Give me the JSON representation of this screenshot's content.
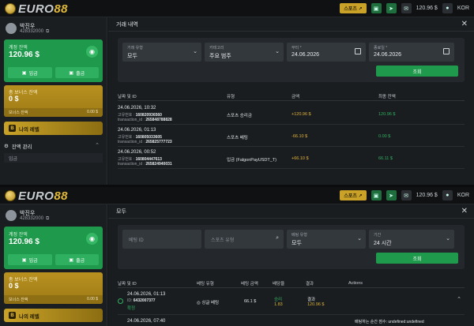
{
  "panels": [
    {
      "topbar": {
        "logo_pre": "EURO",
        "logo_num": "88",
        "pill": "스포츠 ↗",
        "balance": "120.96 $",
        "lang": "KOR"
      },
      "user": {
        "name": "박진우",
        "id": "428332000"
      },
      "balance": {
        "label": "계정 잔액",
        "value": "120.96 $",
        "deposit": "입금",
        "withdraw": "출금"
      },
      "bonus": {
        "label": "총 보너스 잔액",
        "value": "0 $",
        "foot_label": "보너스 잔액",
        "foot_value": "0.00 $"
      },
      "level": "나의 레벨",
      "section": "잔액 관리",
      "subitem": "입금",
      "title": "거래 내역",
      "filters": [
        {
          "label": "거래 유형",
          "value": "모두"
        },
        {
          "label": "카테고리",
          "value": "주요 범주"
        },
        {
          "label": "부터 *",
          "value": "24.06.2026"
        },
        {
          "label": "종료일 *",
          "value": "24.06.2026"
        }
      ],
      "submit": "조회",
      "headers": [
        "날짜 및 ID",
        "유형",
        "금액",
        "최종 잔액"
      ],
      "rows": [
        {
          "date": "24.06.2026, 10:32",
          "code_label": "고유번호 :",
          "code": "160820936560",
          "tx_label": "transaction_id :",
          "tx": "265848788828",
          "type": "스포츠 승리금",
          "amount": "+120.96 $",
          "balance": "120.96 $"
        },
        {
          "date": "24.06.2026, 01:13",
          "code_label": "고유번호 :",
          "code": "160805033605",
          "tx_label": "transaction_id :",
          "tx": "265825777723",
          "type": "스포츠 베팅",
          "amount": "-66.10 $",
          "balance": "0.00 $"
        },
        {
          "date": "24.06.2026, 00:52",
          "code_label": "고유번호 :",
          "code": "160804447613",
          "tx_label": "transaction_id :",
          "tx": "265824940031",
          "type": "입금 (FalgonPayUSDT_T)",
          "amount": "+66.10 $",
          "balance": "66.11 $"
        }
      ]
    },
    {
      "topbar": {
        "logo_pre": "EURO",
        "logo_num": "88",
        "pill": "스포츠 ↗",
        "balance": "120.96 $",
        "lang": "KOR"
      },
      "user": {
        "name": "박진우",
        "id": "428332000"
      },
      "balance": {
        "label": "계정 잔액",
        "value": "120.96 $",
        "deposit": "입금",
        "withdraw": "출금"
      },
      "bonus": {
        "label": "총 보너스 잔액",
        "value": "0 $",
        "foot_label": "보너스 잔액",
        "foot_value": "0.00 $"
      },
      "level": "나의 레벨",
      "title": "모두",
      "filters": [
        {
          "placeholder": "베팅 ID"
        },
        {
          "placeholder": "스포츠 유형"
        },
        {
          "label": "베팅 유형",
          "value": "모두"
        },
        {
          "label": "기간",
          "value": "24 시간"
        }
      ],
      "submit": "조회",
      "headers": [
        "날짜 및 ID",
        "베팅 유형",
        "베팅 금액",
        "배당율",
        "결과",
        "Actions"
      ],
      "row": {
        "date": "24.06.2026, 01:13",
        "id_label": "ID:",
        "id": "6432007377",
        "status": "확정",
        "bet_type": "싱글 베팅",
        "amount": "66.1 $",
        "odds_label": "승리",
        "odds": "1.83",
        "result_label": "결과",
        "result": "120.96 $"
      },
      "row2": {
        "date": "24.06.2026, 07:40",
        "note": "배팅하는 순간 점수: undefined:undefined"
      }
    }
  ]
}
